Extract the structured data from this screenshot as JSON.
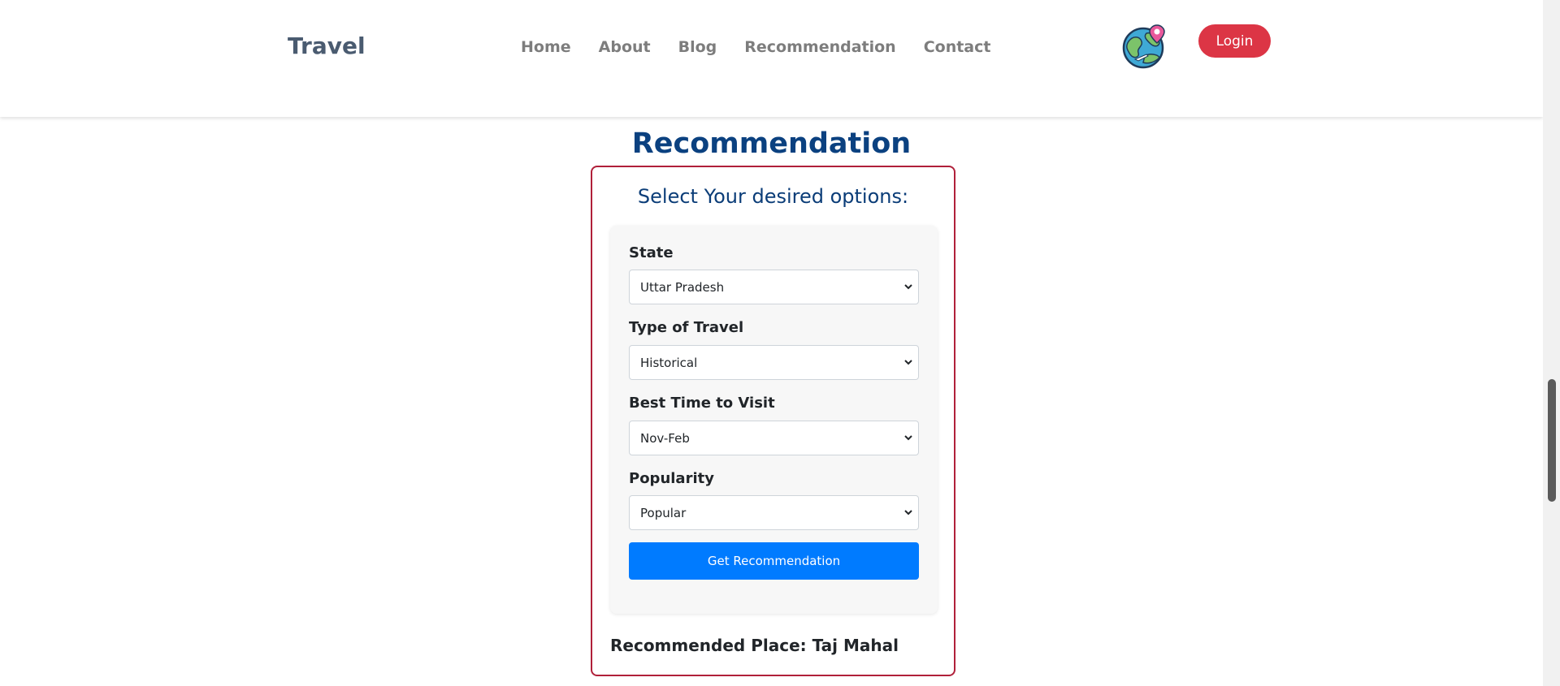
{
  "brand": {
    "title": "Travel"
  },
  "nav": {
    "links": [
      {
        "label": "Home"
      },
      {
        "label": "About"
      },
      {
        "label": "Blog"
      },
      {
        "label": "Recommendation"
      },
      {
        "label": "Contact"
      }
    ],
    "login_label": "Login",
    "logo_icon": "globe-map-pin-icon",
    "login_color": "#dc3545"
  },
  "page": {
    "heading": "Recommendation",
    "card_subtitle": "Select Your desired options:"
  },
  "form": {
    "fields": [
      {
        "label": "State",
        "value": "Uttar Pradesh"
      },
      {
        "label": "Type of Travel",
        "value": "Historical"
      },
      {
        "label": "Best Time to Visit",
        "value": "Nov-Feb"
      },
      {
        "label": "Popularity",
        "value": "Popular"
      }
    ],
    "submit_label": "Get Recommendation",
    "submit_color": "#007bff"
  },
  "result": {
    "text": "Recommended Place: Taj Mahal"
  }
}
